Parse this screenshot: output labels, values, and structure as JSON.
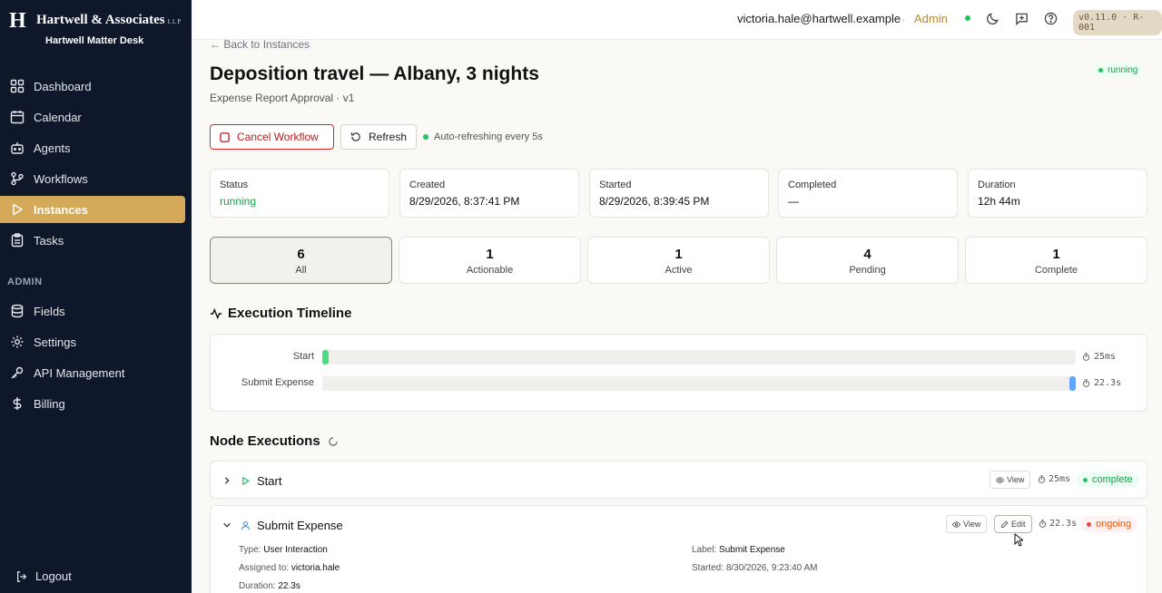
{
  "brand": {
    "logo_letter": "H",
    "name": "Hartwell & Associates",
    "suffix": "LLP",
    "subtitle": "Hartwell Matter Desk"
  },
  "sidebar": {
    "items": [
      {
        "label": "Dashboard",
        "icon": "grid-icon"
      },
      {
        "label": "Calendar",
        "icon": "calendar-icon"
      },
      {
        "label": "Agents",
        "icon": "bot-icon"
      },
      {
        "label": "Workflows",
        "icon": "workflow-icon"
      },
      {
        "label": "Instances",
        "icon": "play-icon",
        "active": true
      },
      {
        "label": "Tasks",
        "icon": "clipboard-icon"
      }
    ],
    "admin_heading": "ADMIN",
    "admin_items": [
      {
        "label": "Fields",
        "icon": "database-icon"
      },
      {
        "label": "Settings",
        "icon": "gear-icon"
      },
      {
        "label": "API Management",
        "icon": "key-icon"
      },
      {
        "label": "Billing",
        "icon": "dollar-icon"
      }
    ],
    "logout": "Logout"
  },
  "topbar": {
    "email": "victoria.hale@hartwell.example",
    "separator": "·",
    "role": "Admin",
    "version": "v0.11.0 · R-001"
  },
  "page": {
    "back": "← Back to Instances",
    "title": "Deposition travel — Albany, 3 nights",
    "subtitle": "Expense Report Approval · v1",
    "status_badge": "running",
    "cancel_label": "Cancel Workflow",
    "refresh_label": "Refresh",
    "auto_refresh": "Auto-refreshing every 5s"
  },
  "info_cards": [
    {
      "label": "Status",
      "value": "running"
    },
    {
      "label": "Created",
      "value": "8/29/2026, 8:37:41 PM"
    },
    {
      "label": "Started",
      "value": "8/29/2026, 8:39:45 PM"
    },
    {
      "label": "Completed",
      "value": "—"
    },
    {
      "label": "Duration",
      "value": "12h 44m"
    }
  ],
  "counts": [
    {
      "num": "6",
      "label": "All"
    },
    {
      "num": "1",
      "label": "Actionable"
    },
    {
      "num": "1",
      "label": "Active"
    },
    {
      "num": "4",
      "label": "Pending"
    },
    {
      "num": "1",
      "label": "Complete"
    }
  ],
  "timeline": {
    "title": "Execution Timeline",
    "rows": [
      {
        "label": "Start",
        "duration": "25ms",
        "start": 0.0,
        "end": 0.008,
        "color": "#4ade80"
      },
      {
        "label": "Submit Expense",
        "duration": "22.3s",
        "start": 0.992,
        "end": 1.0,
        "color": "#60a5fa"
      }
    ]
  },
  "nodes": {
    "title": "Node Executions",
    "view_label": "View",
    "edit_label": "Edit",
    "items": [
      {
        "name": "Start",
        "duration": "25ms",
        "status": "complete"
      },
      {
        "name": "Submit Expense",
        "duration": "22.3s",
        "status": "ongoing"
      }
    ],
    "details": {
      "type_label": "Type:",
      "type_value": "User Interaction",
      "assigned_label": "Assigned to:",
      "assigned_value": "victoria.hale",
      "duration_label": "Duration:",
      "duration_value": "22.3s",
      "name_label": "Label:",
      "name_value": "Submit Expense",
      "started_label": "Started:",
      "started_value": "8/30/2026, 9:23:40 AM"
    }
  }
}
